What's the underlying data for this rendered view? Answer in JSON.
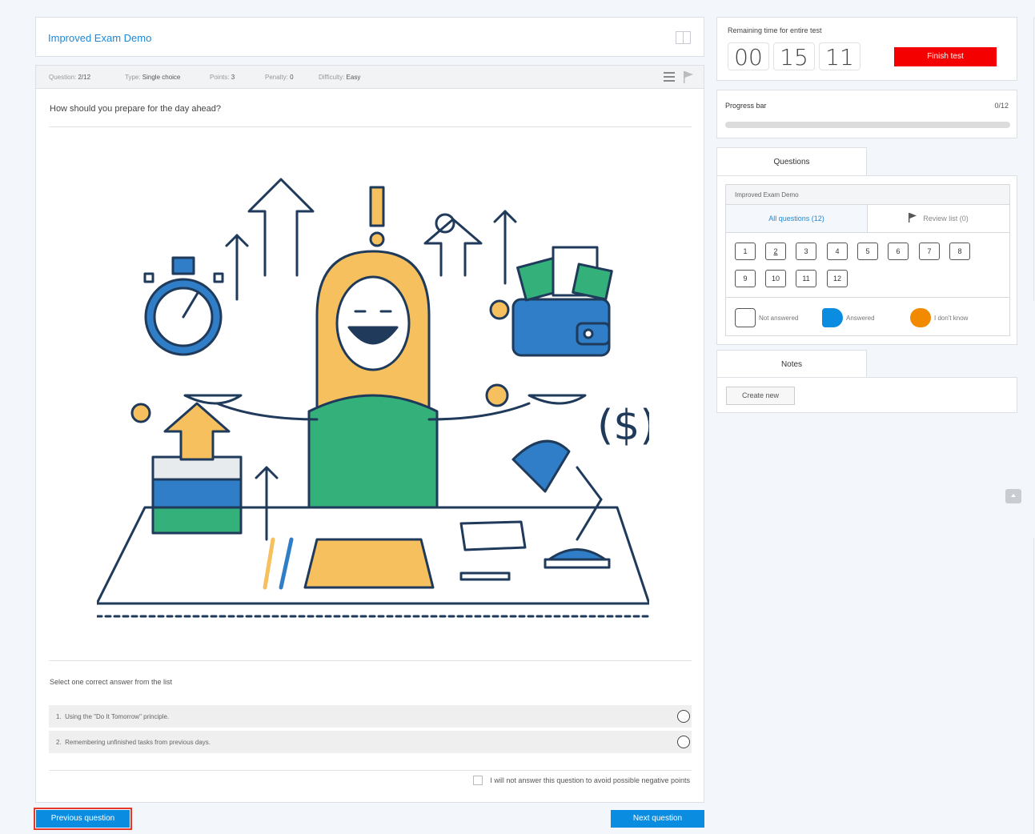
{
  "exam": {
    "title": "Improved Exam Demo"
  },
  "meta": [
    {
      "label": "Question: ",
      "value": "2/12"
    },
    {
      "label": "Type: ",
      "value": "Single choice"
    },
    {
      "label": "Points: ",
      "value": "3"
    },
    {
      "label": "Penalty: ",
      "value": "0"
    },
    {
      "label": "Difficulty: ",
      "value": "Easy"
    }
  ],
  "question": {
    "text": "How should you prepare for the day ahead?",
    "instruction": "Select one correct answer from the list",
    "answers": [
      {
        "num": "1.",
        "text": "Using the \"Do It Tomorrow\" principle."
      },
      {
        "num": "2.",
        "text": "Remembering unfinished tasks from previous days."
      }
    ],
    "skip_label": "I will not answer this question to avoid possible negative points"
  },
  "nav": {
    "prev": "Previous question",
    "next": "Next question"
  },
  "timer": {
    "label": "Remaining time for entire test",
    "hours": "00",
    "minutes": "15",
    "seconds": "11",
    "finish": "Finish test"
  },
  "progress": {
    "label": "Progress bar",
    "value": "0/12",
    "fraction": 0
  },
  "questions_panel": {
    "tab": "Questions",
    "header": "Improved Exam Demo",
    "all_tab": "All questions (12)",
    "review_tab": "Review list (0)",
    "numbers": [
      "1",
      "2",
      "3",
      "4",
      "5",
      "6",
      "7",
      "8",
      "9",
      "10",
      "11",
      "12"
    ],
    "current": "2",
    "legend": {
      "not_answered": "Not answered",
      "answered": "Answered",
      "dont_know": "I don't know"
    }
  },
  "notes": {
    "tab": "Notes",
    "create": "Create new"
  },
  "colors": {
    "accent": "#0a8de0",
    "finish": "#f40000",
    "dont_know": "#f28a00",
    "link": "#1e88d6",
    "highlight": "#e5392f"
  }
}
